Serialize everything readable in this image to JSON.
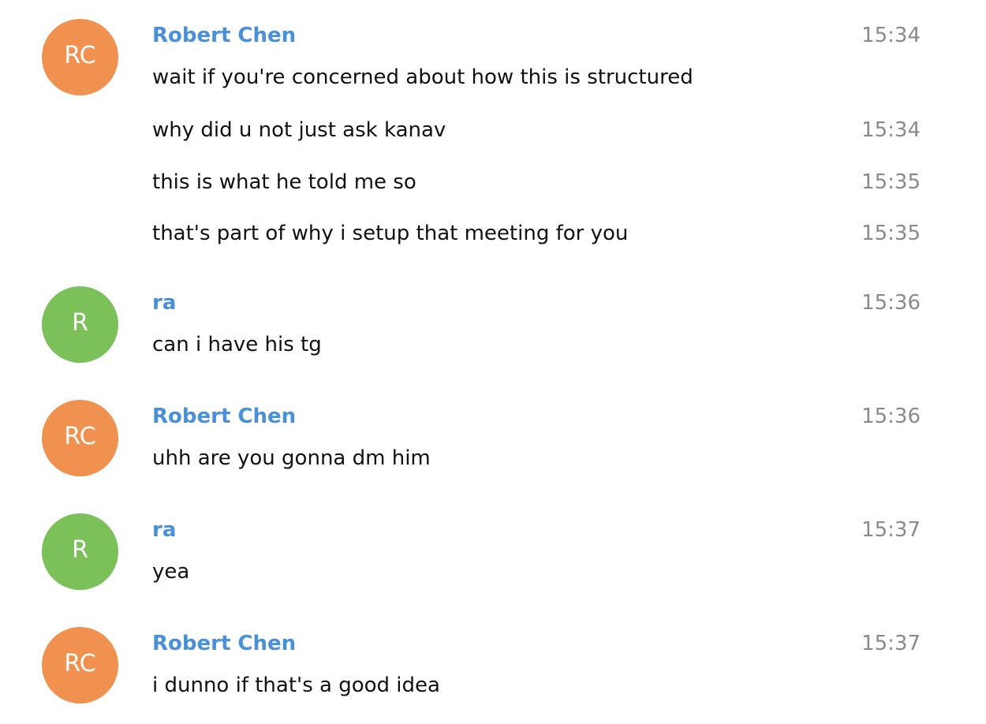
{
  "colors": {
    "robert_avatar": "#f0914f",
    "ra_avatar": "#7cc05a",
    "sender_name": "#4a90d9",
    "message_text": "#111111",
    "timestamp": "#8a8a8a",
    "background": "#ffffff"
  },
  "groups": [
    {
      "avatar_initials": "RC",
      "sender": "Robert Chen",
      "header_time": "15:34",
      "messages": [
        {
          "text": "wait if you're concerned about how this is structured",
          "time": ""
        },
        {
          "text": "why did u not just ask kanav",
          "time": "15:34"
        },
        {
          "text": "this is what he told me so",
          "time": "15:35"
        },
        {
          "text": "that's part of why i setup that meeting for you",
          "time": "15:35"
        }
      ]
    },
    {
      "avatar_initials": "R",
      "sender": "ra",
      "header_time": "15:36",
      "messages": [
        {
          "text": "can i have his tg",
          "time": ""
        }
      ]
    },
    {
      "avatar_initials": "RC",
      "sender": "Robert Chen",
      "header_time": "15:36",
      "messages": [
        {
          "text": "uhh are you gonna dm him",
          "time": ""
        }
      ]
    },
    {
      "avatar_initials": "R",
      "sender": "ra",
      "header_time": "15:37",
      "messages": [
        {
          "text": "yea",
          "time": ""
        }
      ]
    },
    {
      "avatar_initials": "RC",
      "sender": "Robert Chen",
      "header_time": "15:37",
      "messages": [
        {
          "text": "i dunno if that's a good idea",
          "time": ""
        }
      ]
    }
  ]
}
